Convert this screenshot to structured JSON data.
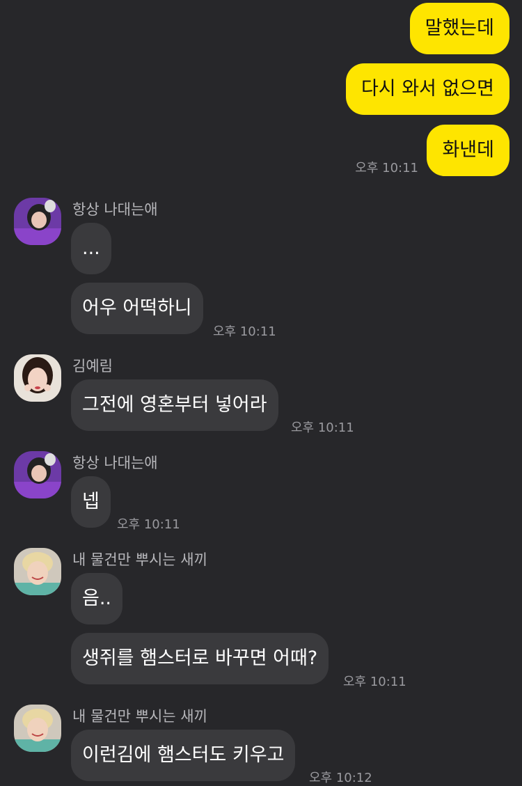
{
  "chat": {
    "outgoing": [
      {
        "text": "말했는데"
      },
      {
        "text": "다시 와서 없으면"
      },
      {
        "text": "화낸데",
        "time": "오후 10:11"
      }
    ],
    "groups": [
      {
        "sender": "항상 나대는애",
        "avatar_icon": "profile-photo-purple",
        "messages": [
          {
            "text": "..."
          },
          {
            "text": "어우 어떡하니",
            "time": "오후 10:11"
          }
        ]
      },
      {
        "sender": "김예림",
        "avatar_icon": "profile-photo-girl",
        "messages": [
          {
            "text": "그전에 영혼부터 넣어라",
            "time": "오후 10:11"
          }
        ]
      },
      {
        "sender": "항상 나대는애",
        "avatar_icon": "profile-photo-purple",
        "messages": [
          {
            "text": "넵",
            "time": "오후 10:11"
          }
        ]
      },
      {
        "sender": "내 물건만 뿌시는 새끼",
        "avatar_icon": "profile-photo-boy",
        "messages": [
          {
            "text": "음.."
          },
          {
            "text": "생쥐를 햄스터로 바꾸면 어때?",
            "time": "오후 10:11"
          }
        ]
      },
      {
        "sender": "내 물건만 뿌시는 새끼",
        "avatar_icon": "profile-photo-boy",
        "messages": [
          {
            "text": "이런김에 햄스터도 키우고",
            "time": "오후 10:12"
          }
        ]
      }
    ]
  },
  "colors": {
    "background": "#27272a",
    "outgoing_bubble": "#fee500",
    "incoming_bubble": "#3a3a3d"
  }
}
